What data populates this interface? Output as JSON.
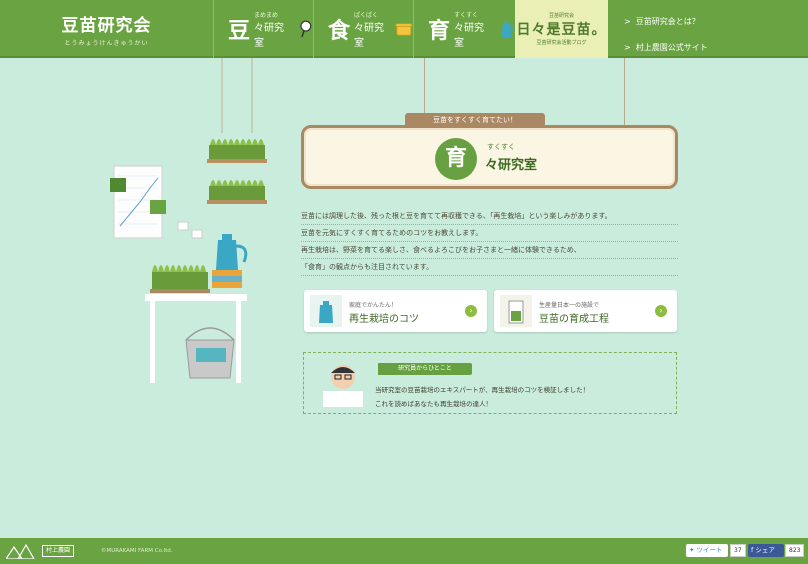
{
  "header": {
    "logo_title": "豆苗研究会",
    "logo_sub": "とうみょうけんきゅうかい",
    "nav": [
      {
        "kanji": "豆",
        "ruby": "まめまめ",
        "label": "々研究室"
      },
      {
        "kanji": "食",
        "ruby": "ぱくぱく",
        "label": "々研究室"
      },
      {
        "kanji": "育",
        "ruby": "すくすく",
        "label": "々研究室"
      }
    ],
    "blog": {
      "top": "豆苗研究会",
      "title": "日々是豆苗。",
      "bottom": "豆苗研究会活動ブログ"
    },
    "links": [
      "豆苗研究会とは？",
      "村上農園公式サイト"
    ]
  },
  "sign": {
    "tag": "豆苗をすくすく育てたい！",
    "circle": "育",
    "ruby": "すくすく",
    "title": "々研究室"
  },
  "description": [
    "豆苗には調理した後、残った根と豆を育てて再収穫できる、「再生栽培」という楽しみがあります。",
    "豆苗を元気にすくすく育てるためのコツをお教えします。",
    "再生栽培は、野菜を育てる楽しさ、食べるよろこびをお子さまと一緒に体験できるため、",
    "「食育」の観点からも注目されています。"
  ],
  "cards": [
    {
      "sub": "家庭でかんたん！",
      "title": "再生栽培のコツ"
    },
    {
      "sub": "生産量日本一の施設で",
      "title": "豆苗の育成工程"
    }
  ],
  "message": {
    "tag": "研究員からひとこと",
    "lines": [
      "当研究室の豆苗栽培のエキスパートが、再生栽培のコツを検証しました！",
      "これを読めばあなたも再生栽培の達人！"
    ]
  },
  "footer": {
    "brand": "村上農園",
    "copyright": "©MURAKAMI FARM Co.ltd.",
    "tweet_label": "ツイート",
    "tweet_count": "37",
    "share_label": "シェア",
    "share_count": "823"
  },
  "colors": {
    "green": "#6aa341",
    "mint": "#c9ecdc",
    "sign_border": "#a98863"
  }
}
